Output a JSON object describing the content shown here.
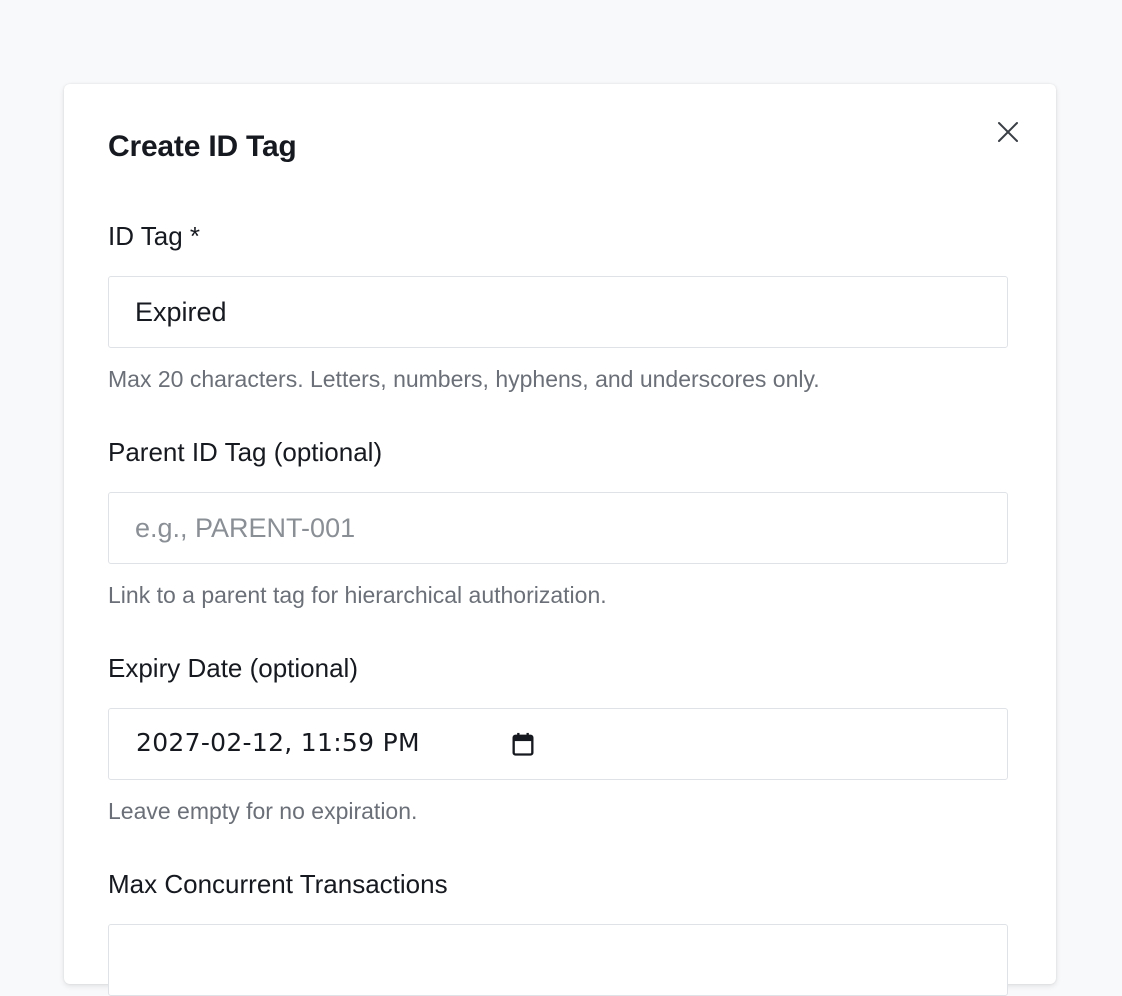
{
  "modal": {
    "title": "Create ID Tag",
    "close_icon": "close-icon"
  },
  "fields": {
    "id_tag": {
      "label": "ID Tag *",
      "value": "Expired",
      "help": "Max 20 characters. Letters, numbers, hyphens, and underscores only."
    },
    "parent_id_tag": {
      "label": "Parent ID Tag (optional)",
      "value": "",
      "placeholder": "e.g., PARENT-001",
      "help": "Link to a parent tag for hierarchical authorization."
    },
    "expiry_date": {
      "label": "Expiry Date (optional)",
      "value": "2027-02-12, 11:59  PM",
      "icon": "calendar-icon",
      "help": "Leave empty for no expiration."
    },
    "max_concurrent": {
      "label": "Max Concurrent Transactions"
    }
  },
  "colors": {
    "page_background": "#f8f9fb",
    "text_primary": "#16191f",
    "text_muted": "#6b7078",
    "input_border": "#dfe2e6"
  }
}
